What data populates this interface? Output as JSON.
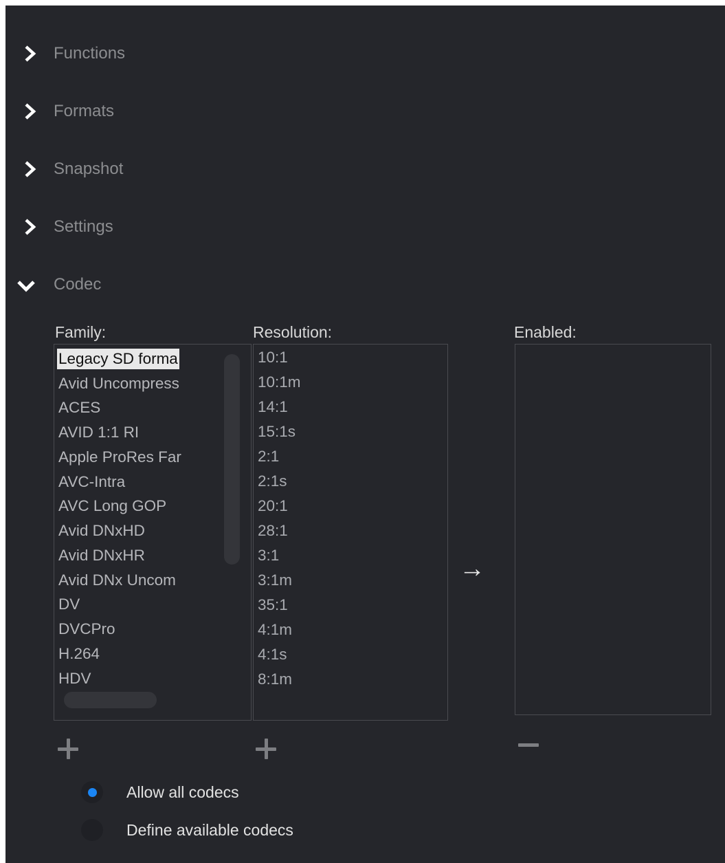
{
  "sections": [
    {
      "label": "Functions",
      "expanded": false
    },
    {
      "label": "Formats",
      "expanded": false
    },
    {
      "label": "Snapshot",
      "expanded": false
    },
    {
      "label": "Settings",
      "expanded": false
    },
    {
      "label": "Codec",
      "expanded": true
    }
  ],
  "codec": {
    "family_label": "Family:",
    "resolution_label": "Resolution:",
    "enabled_label": "Enabled:",
    "family_items": [
      "Legacy SD forma",
      "Avid Uncompress",
      "ACES",
      "AVID 1:1 RI",
      "Apple ProRes Far",
      "AVC-Intra",
      "AVC Long GOP",
      "Avid DNxHD",
      "Avid DNxHR",
      "Avid DNx Uncom",
      "DV",
      "DVCPro",
      "H.264",
      "HDV"
    ],
    "family_selected": "Legacy SD forma",
    "resolution_items": [
      "10:1",
      "10:1m",
      "14:1",
      "15:1s",
      "2:1",
      "2:1s",
      "20:1",
      "28:1",
      "3:1",
      "3:1m",
      "35:1",
      "4:1m",
      "4:1s",
      "8:1m"
    ],
    "enabled_items": [],
    "add_family_symbol": "+",
    "add_resolution_symbol": "+",
    "remove_enabled_symbol": "−",
    "move_arrow": "→",
    "radio_options": [
      {
        "label": "Allow all codecs",
        "selected": true
      },
      {
        "label": "Define available codecs",
        "selected": false
      }
    ]
  },
  "colors": {
    "background": "#25262b",
    "accent": "#1b86f5"
  }
}
